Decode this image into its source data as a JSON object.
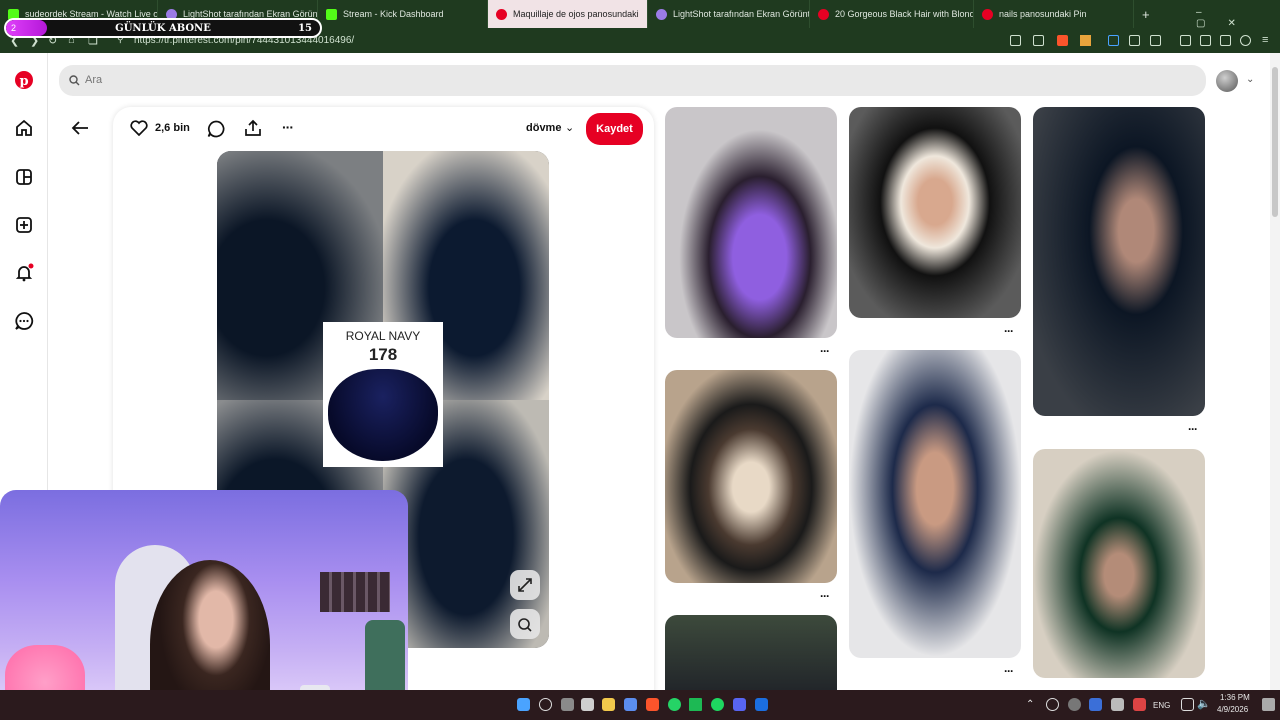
{
  "browser": {
    "tabs": [
      {
        "label": "sudeordek Stream - Watch Live o",
        "color": "#53fc18"
      },
      {
        "label": "LightShot tarafından Ekran Görüntü",
        "color": "#9b7be6"
      },
      {
        "label": "Stream - Kick Dashboard",
        "color": "#53fc18"
      },
      {
        "label": "Maquillaje de ojos panosundaki",
        "color": "#e60023",
        "active": true
      },
      {
        "label": "LightShot tarafından Ekran Görüntü",
        "color": "#9b7be6"
      },
      {
        "label": "20 Gorgeous Black Hair with Blonde",
        "color": "#e60023"
      },
      {
        "label": "nails panosundaki Pin",
        "color": "#e60023"
      }
    ],
    "new_tab_label": "+",
    "url": "https://tr.pinterest.com/pin/744431013444016496/"
  },
  "overlay": {
    "title": "GÜNLÜK ABONE",
    "current": "2",
    "goal": "15",
    "progress": 0.13
  },
  "search": {
    "placeholder": "Ara"
  },
  "pin": {
    "like_count": "2,6 bin",
    "board_name": "dövme",
    "save_label": "Kaydet",
    "swatch_name": "ROYAL NAVY",
    "swatch_number": "178"
  },
  "more_label": "···",
  "taskbar": {
    "lang": "ENG",
    "time": "1:36 PM",
    "date": "4/9/2026"
  }
}
